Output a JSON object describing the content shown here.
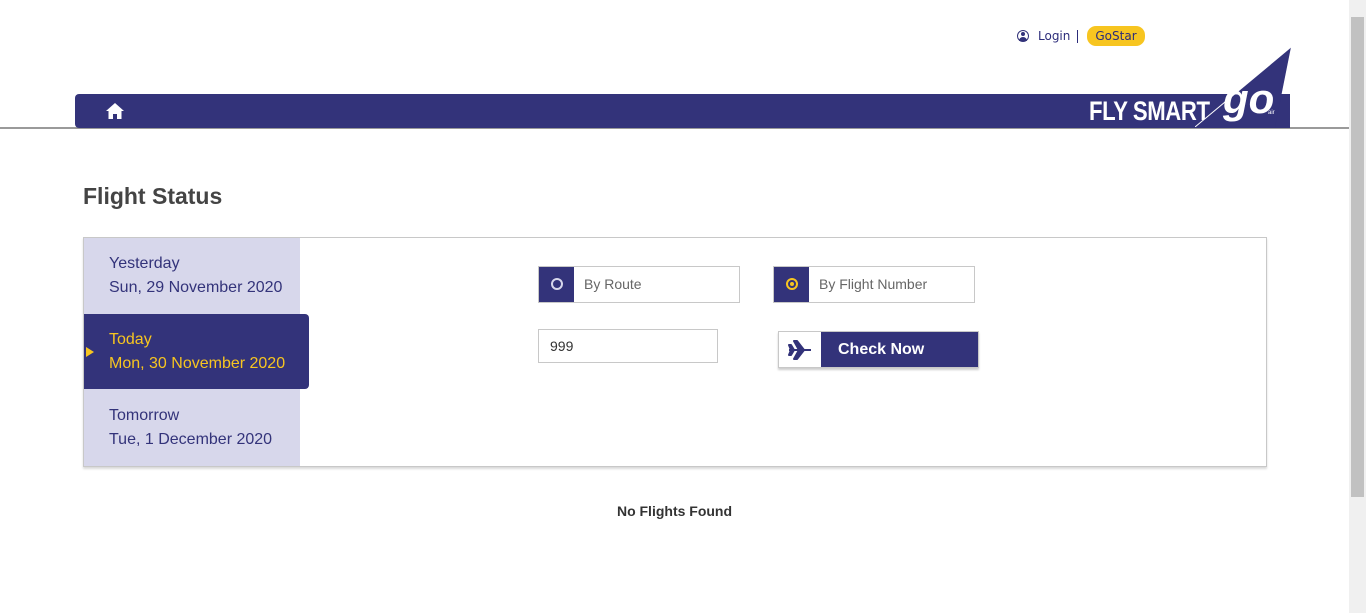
{
  "header": {
    "login_label": "Login",
    "gostar_label": "GoStar",
    "brand_text": "FLY SMART",
    "logo_text": "go air"
  },
  "page": {
    "title": "Flight Status"
  },
  "days": {
    "yesterday": {
      "label": "Yesterday",
      "date": "Sun, 29 November 2020"
    },
    "today": {
      "label": "Today",
      "date": "Mon, 30 November 2020"
    },
    "tomorrow": {
      "label": "Tomorrow",
      "date": "Tue, 1 December 2020"
    }
  },
  "search": {
    "by_route_label": "By Route",
    "by_flight_number_label": "By Flight Number",
    "selected_mode": "By Flight Number",
    "flight_number_value": "999",
    "check_now_label": "Check Now"
  },
  "results": {
    "message": "No Flights Found"
  },
  "colors": {
    "brand_navy": "#33337a",
    "accent_yellow": "#f7c520",
    "day_panel_bg": "#d7d7eb"
  },
  "icons": [
    "user-icon",
    "home-icon",
    "plane-icon",
    "radio-icon"
  ]
}
